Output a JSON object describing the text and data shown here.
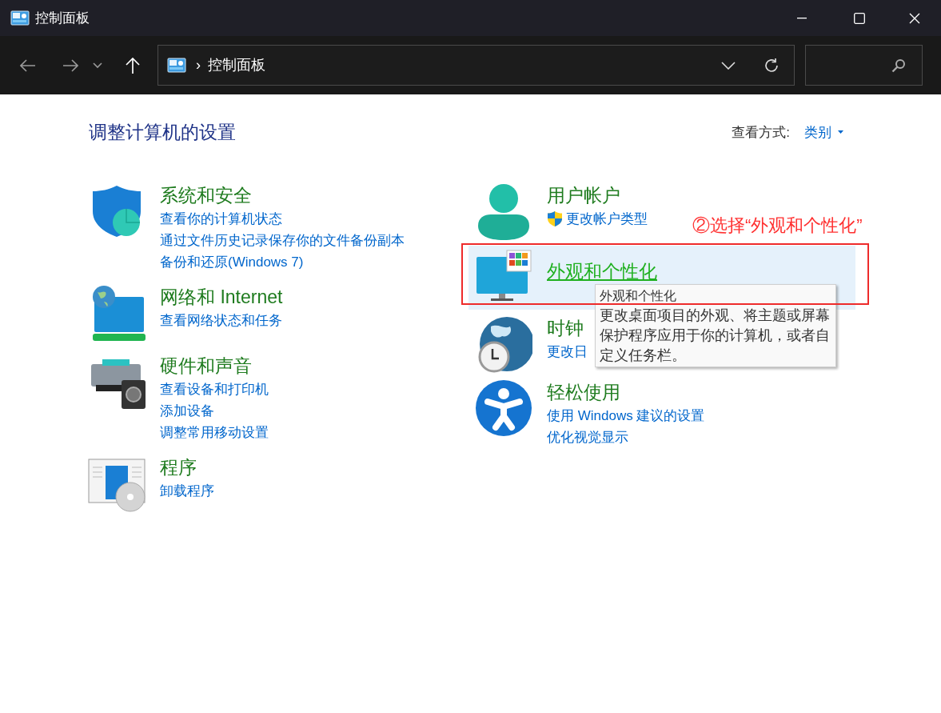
{
  "window": {
    "title": "控制面板"
  },
  "address_bar": {
    "separator": "›",
    "breadcrumb": "控制面板"
  },
  "heading": "调整计算机的设置",
  "view_by": {
    "label": "查看方式:",
    "value": "类别"
  },
  "columns": [
    {
      "categories": [
        {
          "title": "系统和安全",
          "selected": false,
          "links": [
            {
              "text": "查看你的计算机状态",
              "kind": "plain"
            },
            {
              "text": "通过文件历史记录保存你的文件备份副本",
              "kind": "plain"
            },
            {
              "text": "备份和还原(Windows 7)",
              "kind": "plain"
            }
          ]
        },
        {
          "title": "网络和 Internet",
          "selected": false,
          "links": [
            {
              "text": "查看网络状态和任务",
              "kind": "plain"
            }
          ]
        },
        {
          "title": "硬件和声音",
          "selected": false,
          "links": [
            {
              "text": "查看设备和打印机",
              "kind": "plain"
            },
            {
              "text": "添加设备",
              "kind": "plain"
            },
            {
              "text": "调整常用移动设置",
              "kind": "plain"
            }
          ]
        },
        {
          "title": "程序",
          "selected": false,
          "links": [
            {
              "text": "卸载程序",
              "kind": "plain"
            }
          ]
        }
      ]
    },
    {
      "categories": [
        {
          "title": "用户帐户",
          "selected": false,
          "links": [
            {
              "text": "更改帐户类型",
              "kind": "shield"
            }
          ]
        },
        {
          "title": "外观和个性化",
          "selected": true
        },
        {
          "title": "时钟",
          "selected": false,
          "links": [
            {
              "text": "更改日",
              "kind": "plain"
            }
          ]
        },
        {
          "title": "轻松使用",
          "selected": false,
          "links": [
            {
              "text": "使用 Windows 建议的设置",
              "kind": "plain"
            },
            {
              "text": "优化视觉显示",
              "kind": "plain"
            }
          ]
        }
      ]
    }
  ],
  "tooltip": {
    "title": "外观和个性化",
    "text": "更改桌面项目的外观、将主题或屏幕保护程序应用于你的计算机，或者自定义任务栏。"
  },
  "annotation": "②选择“外观和个性化”"
}
